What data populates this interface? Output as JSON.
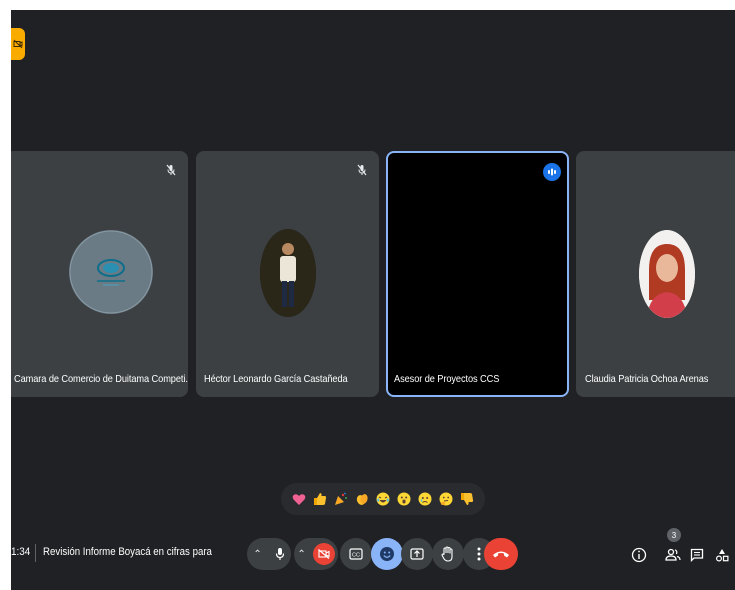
{
  "participants": [
    {
      "name": "Camara de Comercio de Duitama Competi...",
      "muted": true
    },
    {
      "name": "Héctor Leonardo García Castañeda",
      "muted": true
    },
    {
      "name": "Asesor de Proyectos CCS",
      "speaking": true
    },
    {
      "name": "Claudia Patricia Ochoa Arenas"
    }
  ],
  "bottom_bar": {
    "time": "1:34",
    "separator": "|",
    "meeting_title": "Revisión Informe Boyacá en cifras para",
    "participants_count": "3"
  },
  "colors": {
    "background": "#202124",
    "tile": "#3c4043",
    "active_border": "#8ab4f8",
    "hangup": "#ea4335",
    "badge": "#f9ab00"
  },
  "reactions": [
    "heart",
    "thumbs-up",
    "party-popper",
    "clapping",
    "laughing",
    "surprised",
    "sad",
    "thinking",
    "thumbs-down"
  ]
}
